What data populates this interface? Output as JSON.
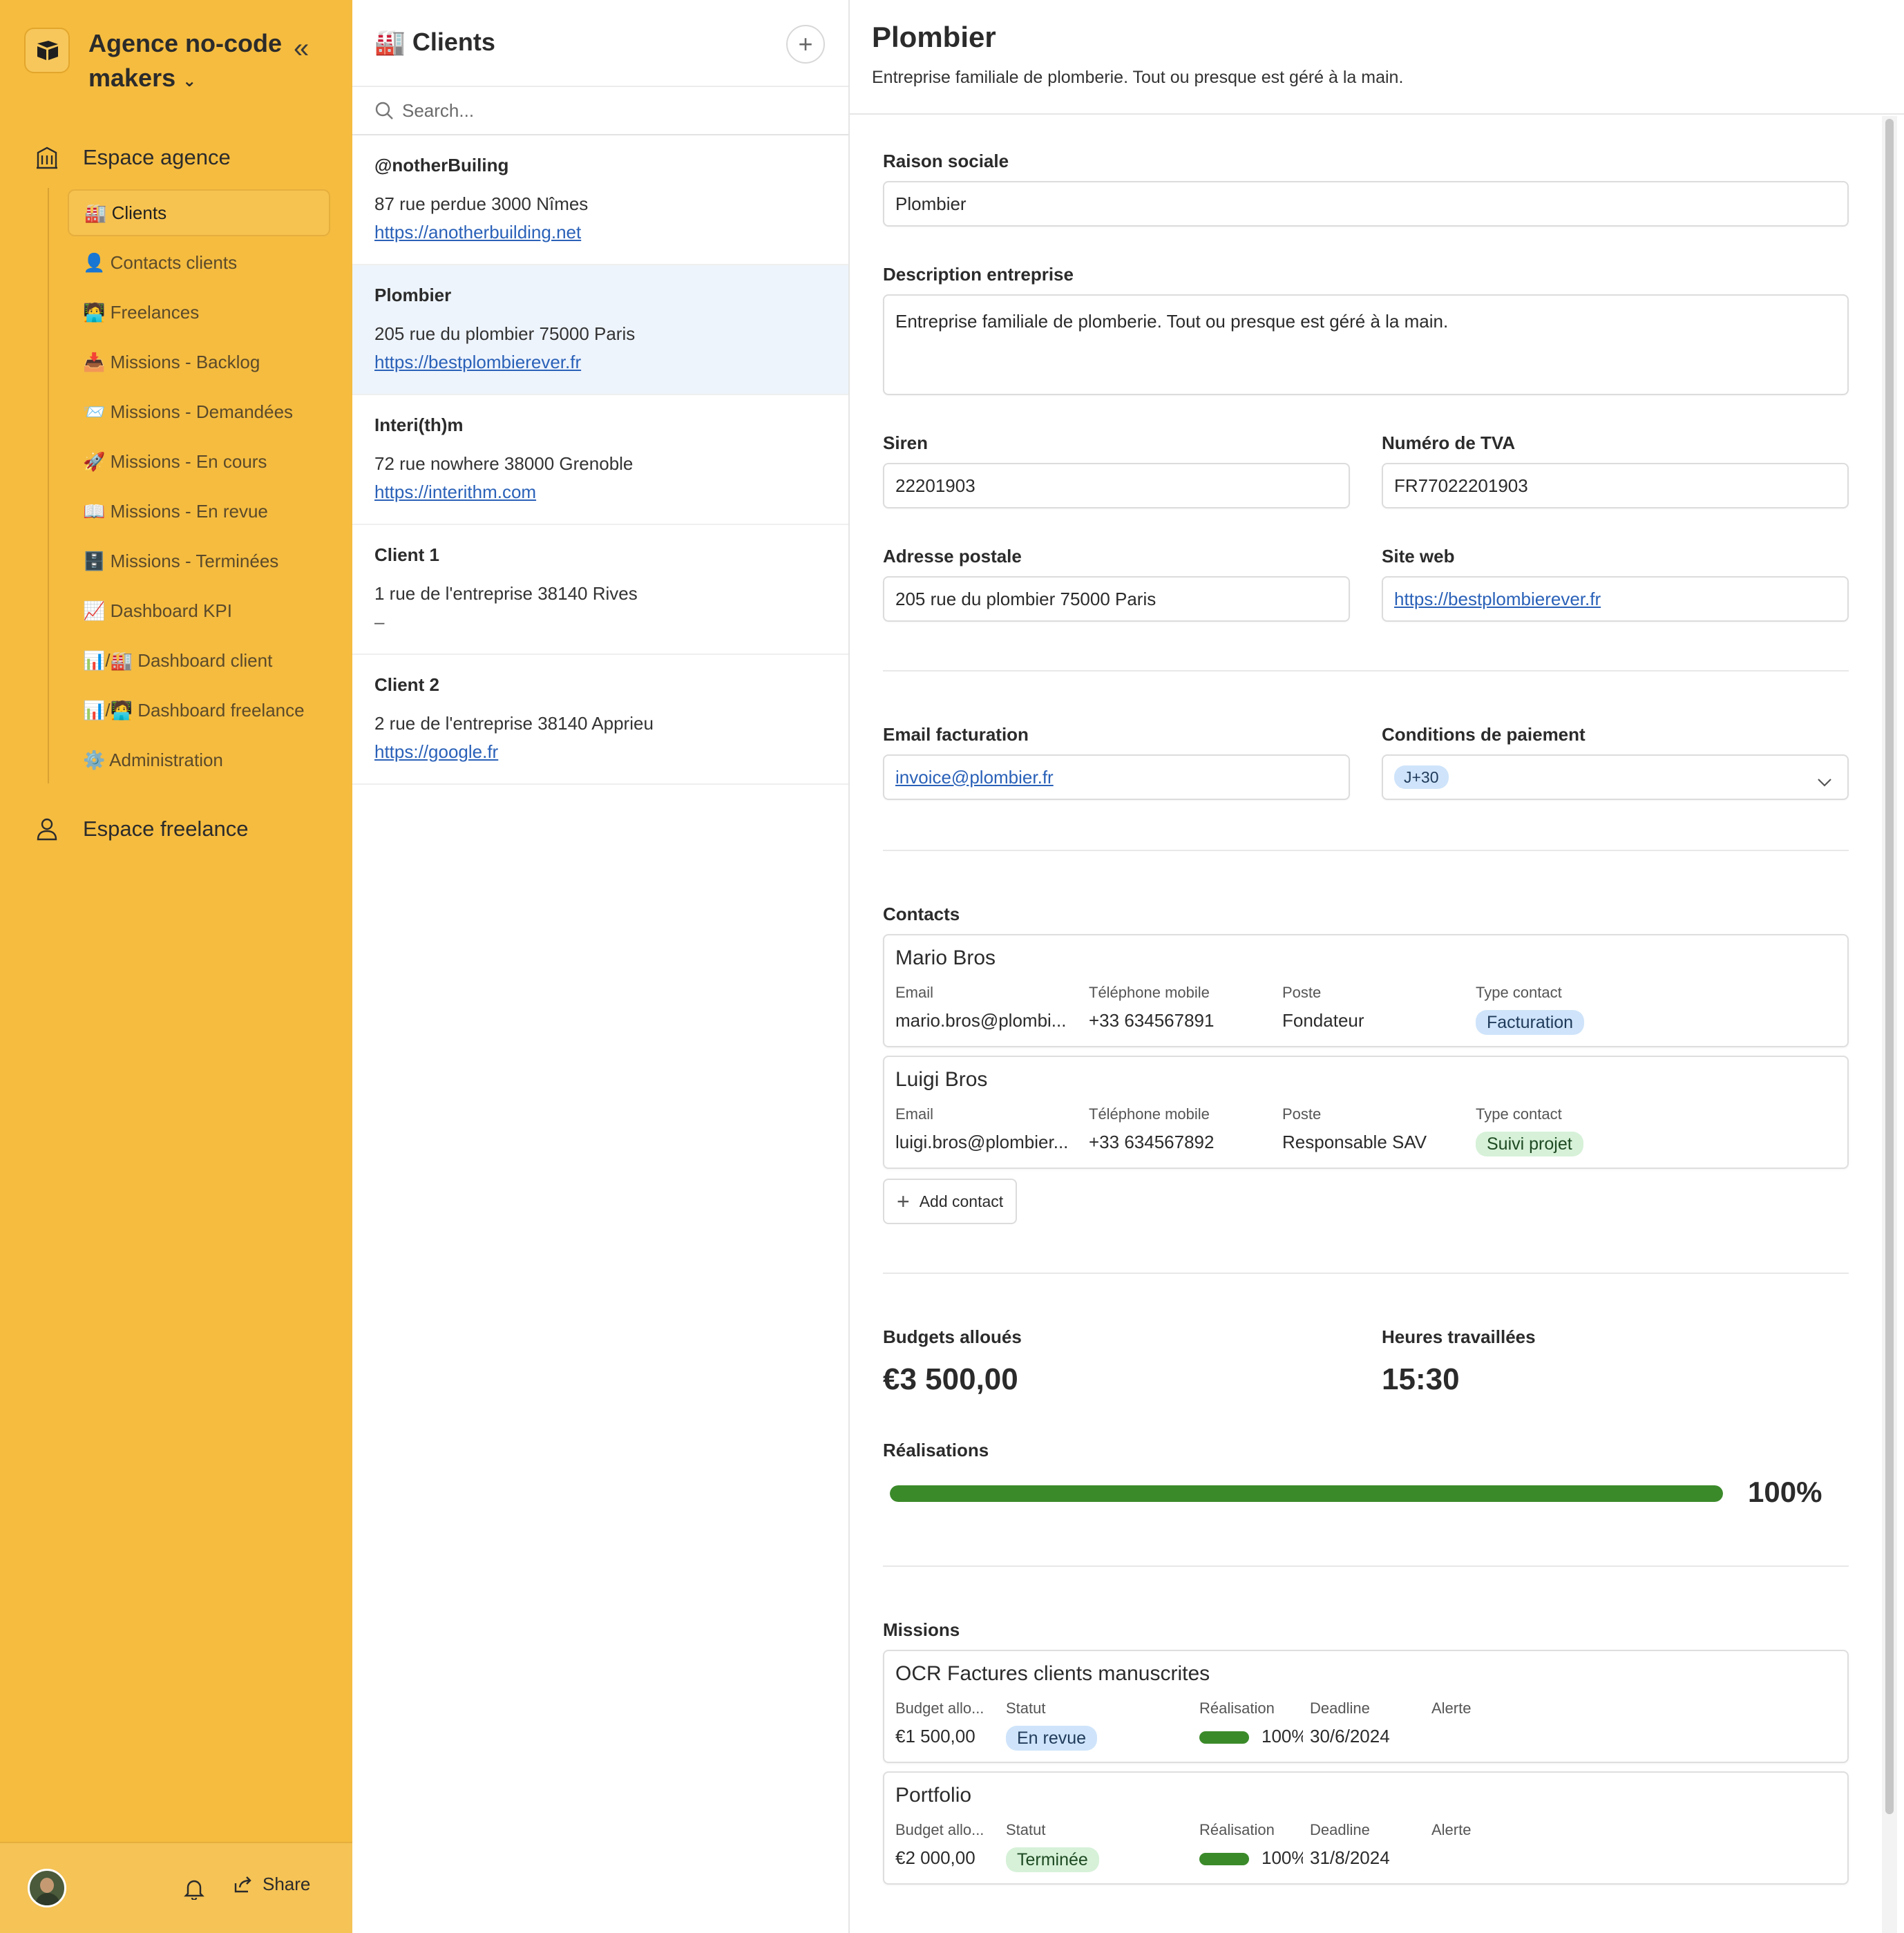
{
  "sidebar": {
    "workspace_name": "Agence no-code makers",
    "sections": {
      "agence": "Espace agence",
      "freelance": "Espace freelance"
    },
    "items": [
      {
        "label": "🏭 Clients",
        "active": true
      },
      {
        "label": "👤 Contacts clients"
      },
      {
        "label": "🧑‍💻 Freelances"
      },
      {
        "label": "📥 Missions - Backlog"
      },
      {
        "label": "📨 Missions - Demandées"
      },
      {
        "label": "🚀 Missions - En cours"
      },
      {
        "label": "📖 Missions - En revue"
      },
      {
        "label": "🗄️ Missions - Terminées"
      },
      {
        "label": "📈 Dashboard KPI"
      },
      {
        "label": "📊/🏭 Dashboard client"
      },
      {
        "label": "📊/🧑‍💻 Dashboard freelance"
      },
      {
        "label": "⚙️ Administration"
      }
    ],
    "footer": {
      "share_label": "Share"
    }
  },
  "list": {
    "title": "🏭 Clients",
    "search_placeholder": "Search...",
    "clients": [
      {
        "name": "@notherBuiling",
        "address": "87 rue perdue 3000 Nîmes",
        "url": "https://anotherbuilding.net"
      },
      {
        "name": "Plombier",
        "address": "205 rue du plombier 75000 Paris",
        "url": "https://bestplombierever.fr",
        "selected": true
      },
      {
        "name": "Interi(th)m",
        "address": "72 rue nowhere 38000 Grenoble",
        "url": "https://interithm.com"
      },
      {
        "name": "Client 1",
        "address": "1 rue de l'entreprise 38140 Rives",
        "url": "–"
      },
      {
        "name": "Client 2",
        "address": "2 rue de l'entreprise 38140 Apprieu",
        "url": "https://google.fr"
      }
    ]
  },
  "detail": {
    "title": "Plombier",
    "description": "Entreprise familiale de plomberie. Tout ou presque est géré à la main.",
    "fields": {
      "raison_sociale": {
        "label": "Raison sociale",
        "value": "Plombier"
      },
      "description": {
        "label": "Description entreprise",
        "value": "Entreprise familiale de plomberie. Tout ou presque est géré à la main."
      },
      "siren": {
        "label": "Siren",
        "value": "22201903"
      },
      "tva": {
        "label": "Numéro de TVA",
        "value": "FR77022201903"
      },
      "adresse": {
        "label": "Adresse postale",
        "value": "205 rue du plombier 75000 Paris"
      },
      "site": {
        "label": "Site web",
        "value": "https://bestplombierever.fr"
      },
      "email": {
        "label": "Email facturation",
        "value": "invoice@plombier.fr"
      },
      "conditions": {
        "label": "Conditions de paiement",
        "value": "J+30"
      }
    },
    "contacts": {
      "label": "Contacts",
      "col_labels": {
        "email": "Email",
        "phone": "Téléphone mobile",
        "poste": "Poste",
        "type": "Type contact"
      },
      "items": [
        {
          "name": "Mario Bros",
          "email": "mario.bros@plombi...",
          "phone": "+33 634567891",
          "poste": "Fondateur",
          "type": "Facturation"
        },
        {
          "name": "Luigi Bros",
          "email": "luigi.bros@plombier...",
          "phone": "+33 634567892",
          "poste": "Responsable SAV",
          "type": "Suivi projet"
        }
      ],
      "add_label": "Add contact"
    },
    "stats": {
      "budget_label": "Budgets alloués",
      "budget_value": "€3 500,00",
      "heures_label": "Heures travaillées",
      "heures_value": "15:30",
      "realisation_label": "Réalisations",
      "realisation_value": "100%",
      "realisation_fraction": 1.0
    },
    "missions": {
      "label": "Missions",
      "col_labels": {
        "budget": "Budget allo...",
        "statut": "Statut",
        "realisation": "Réalisation",
        "deadline": "Deadline",
        "alerte": "Alerte"
      },
      "items": [
        {
          "name": "OCR Factures clients manuscrites",
          "budget": "€1 500,00",
          "statut": "En revue",
          "realisation": "100%",
          "deadline": "30/6/2024"
        },
        {
          "name": "Portfolio",
          "budget": "€2 000,00",
          "statut": "Terminée",
          "realisation": "100%",
          "deadline": "31/8/2024"
        }
      ]
    }
  },
  "colors": {
    "sidebar": "#F5BC40",
    "accent_link": "#2a61b8",
    "progress": "#3B8A2A",
    "tag_blue": "#CFE4FA",
    "tag_green": "#D6F1D8"
  }
}
